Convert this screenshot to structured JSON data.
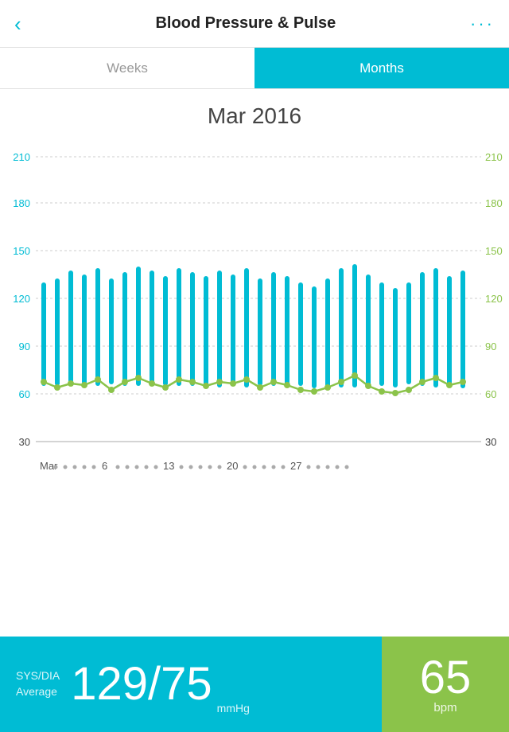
{
  "header": {
    "title": "Blood Pressure & Pulse",
    "back_label": "‹",
    "more_label": "···"
  },
  "tabs": [
    {
      "label": "Weeks",
      "active": false
    },
    {
      "label": "Months",
      "active": true
    }
  ],
  "chart": {
    "title": "Mar 2016",
    "y_labels_left": [
      "210",
      "180",
      "150",
      "120",
      "90",
      "60",
      "30"
    ],
    "y_labels_right": [
      "210",
      "180",
      "150",
      "120",
      "90",
      "60",
      "30"
    ],
    "x_labels": [
      "Mar",
      "6",
      "13",
      "20",
      "27"
    ],
    "accent_color": "#00bcd4",
    "line_color": "#8bc34a"
  },
  "stats": {
    "left_label_line1": "SYS/DIA",
    "left_label_line2": "Average",
    "left_value": "129/75",
    "left_unit": "mmHg",
    "right_value": "65",
    "right_unit": "bpm"
  }
}
